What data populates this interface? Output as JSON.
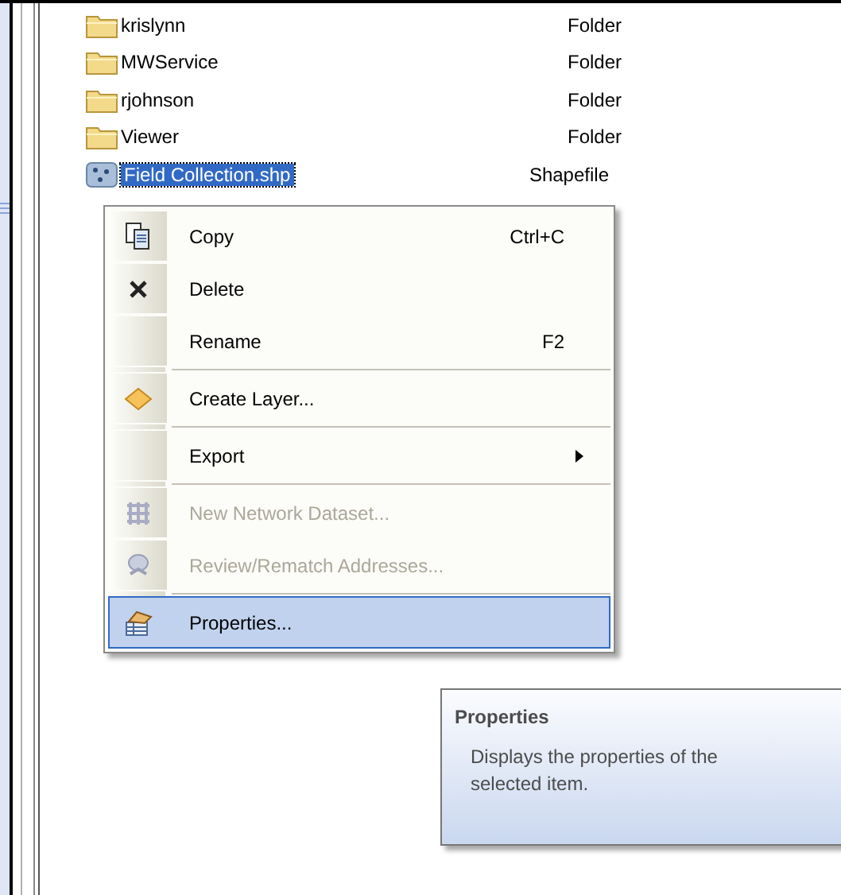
{
  "file_list": [
    {
      "name": "krislynn",
      "type": "Folder",
      "kind": "folder",
      "selected": false
    },
    {
      "name": "MWService",
      "type": "Folder",
      "kind": "folder",
      "selected": false
    },
    {
      "name": "rjohnson",
      "type": "Folder",
      "kind": "folder",
      "selected": false
    },
    {
      "name": "Viewer",
      "type": "Folder",
      "kind": "folder",
      "selected": false
    },
    {
      "name": "Field Collection.shp",
      "type": "Shapefile",
      "kind": "shapefile",
      "selected": true
    }
  ],
  "context_menu": [
    {
      "kind": "item",
      "label": "Copy",
      "shortcut": "Ctrl+C",
      "disabled": false,
      "selected": false,
      "submenu": false
    },
    {
      "kind": "item",
      "label": "Delete",
      "disabled": false,
      "selected": false,
      "submenu": false
    },
    {
      "kind": "item",
      "label": "Rename",
      "shortcut": "F2",
      "disabled": false,
      "selected": false,
      "submenu": false
    },
    {
      "kind": "separator"
    },
    {
      "kind": "item",
      "label": "Create Layer...",
      "disabled": false,
      "selected": false,
      "submenu": false
    },
    {
      "kind": "separator"
    },
    {
      "kind": "item",
      "label": "Export",
      "disabled": false,
      "selected": false,
      "submenu": true
    },
    {
      "kind": "separator"
    },
    {
      "kind": "item",
      "label": "New Network Dataset...",
      "disabled": true,
      "selected": false,
      "submenu": false
    },
    {
      "kind": "item",
      "label": "Review/Rematch Addresses...",
      "disabled": true,
      "selected": false,
      "submenu": false
    },
    {
      "kind": "separator"
    },
    {
      "kind": "item",
      "label": "Properties...",
      "disabled": false,
      "selected": true,
      "submenu": false
    }
  ],
  "tooltip": {
    "title": "Properties",
    "description": "Displays the properties of the selected item."
  }
}
